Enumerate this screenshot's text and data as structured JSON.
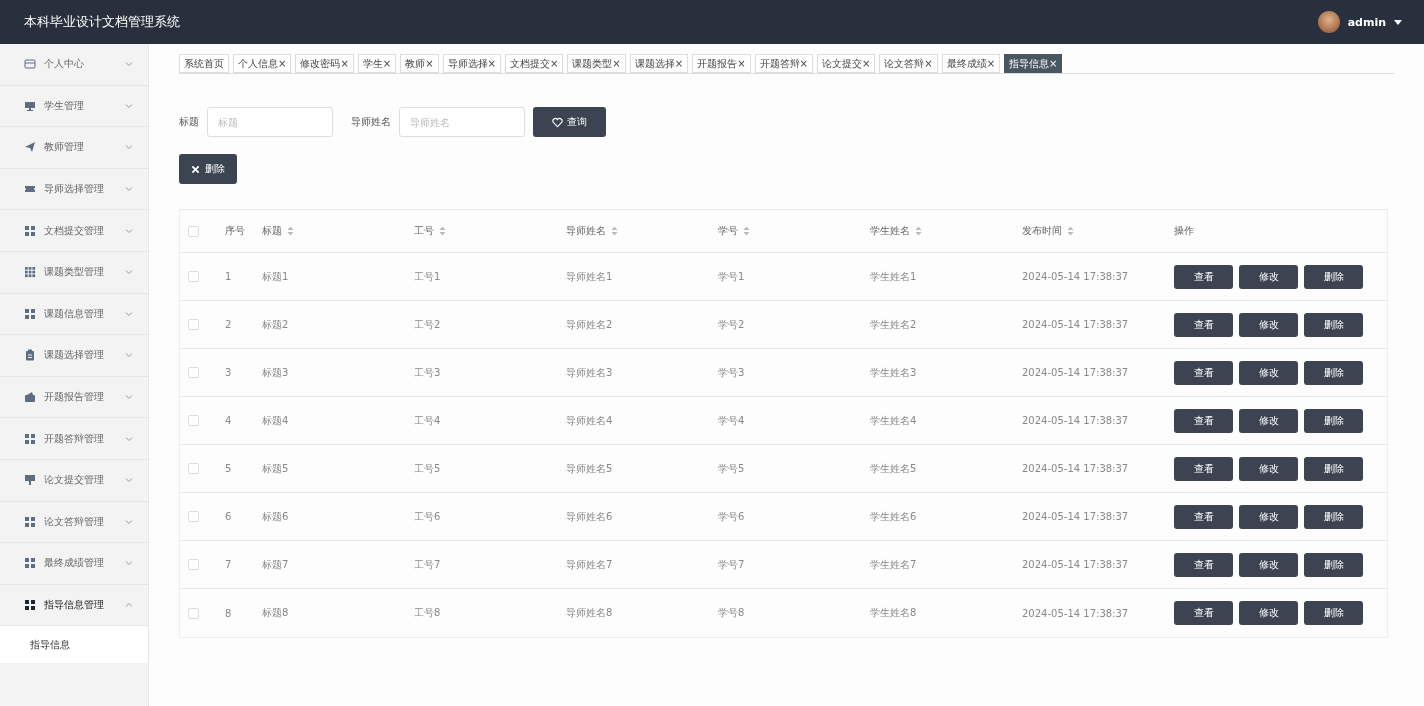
{
  "header": {
    "title": "本科毕业设计文档管理系统",
    "user": "admin"
  },
  "sidebar": {
    "items": [
      {
        "label": "个人中心",
        "expanded": false
      },
      {
        "label": "学生管理",
        "expanded": false
      },
      {
        "label": "教师管理",
        "expanded": false
      },
      {
        "label": "导师选择管理",
        "expanded": false
      },
      {
        "label": "文档提交管理",
        "expanded": false
      },
      {
        "label": "课题类型管理",
        "expanded": false
      },
      {
        "label": "课题信息管理",
        "expanded": false
      },
      {
        "label": "课题选择管理",
        "expanded": false
      },
      {
        "label": "开题报告管理",
        "expanded": false
      },
      {
        "label": "开题答辩管理",
        "expanded": false
      },
      {
        "label": "论文提交管理",
        "expanded": false
      },
      {
        "label": "论文答辩管理",
        "expanded": false
      },
      {
        "label": "最终成绩管理",
        "expanded": false
      },
      {
        "label": "指导信息管理",
        "expanded": true,
        "children": [
          {
            "label": "指导信息"
          }
        ]
      }
    ]
  },
  "tabs": [
    {
      "label": "系统首页",
      "selected": false
    },
    {
      "label": "个人信息",
      "close": "×",
      "selected": false
    },
    {
      "label": "修改密码",
      "close": "×",
      "selected": false
    },
    {
      "label": "学生",
      "close": "×",
      "selected": false
    },
    {
      "label": "教师",
      "close": "×",
      "selected": false
    },
    {
      "label": "导师选择",
      "close": "×",
      "selected": false
    },
    {
      "label": "文档提交",
      "close": "×",
      "selected": false
    },
    {
      "label": "课题类型",
      "close": "×",
      "selected": false
    },
    {
      "label": "课题选择",
      "close": "×",
      "selected": false
    },
    {
      "label": "开题报告",
      "close": "×",
      "selected": false
    },
    {
      "label": "开题答辩",
      "close": "×",
      "selected": false
    },
    {
      "label": "论文提交",
      "close": "×",
      "selected": false
    },
    {
      "label": "论文答辩",
      "close": "×",
      "selected": false
    },
    {
      "label": "最终成绩",
      "close": "×",
      "selected": false
    },
    {
      "label": "指导信息",
      "close": "×",
      "selected": true
    }
  ],
  "search": {
    "fields": [
      {
        "label": "标题",
        "placeholder": "标题"
      },
      {
        "label": "导师姓名",
        "placeholder": "导师姓名"
      }
    ],
    "button": "查询"
  },
  "delete_button": "删除",
  "table": {
    "header_checked": false,
    "columns": [
      {
        "label": "序号",
        "sortable": false
      },
      {
        "label": "标题",
        "sortable": true
      },
      {
        "label": "工号",
        "sortable": true
      },
      {
        "label": "导师姓名",
        "sortable": true
      },
      {
        "label": "学号",
        "sortable": true
      },
      {
        "label": "学生姓名",
        "sortable": true
      },
      {
        "label": "发布时间",
        "sortable": true
      },
      {
        "label": "操作",
        "sortable": false
      }
    ],
    "rows": [
      {
        "checked": false,
        "cells": [
          "1",
          "标题1",
          "工号1",
          "导师姓名1",
          "学号1",
          "学生姓名1",
          "2024-05-14 17:38:37"
        ],
        "actions": [
          "查看",
          "修改",
          "删除"
        ]
      },
      {
        "checked": false,
        "cells": [
          "2",
          "标题2",
          "工号2",
          "导师姓名2",
          "学号2",
          "学生姓名2",
          "2024-05-14 17:38:37"
        ],
        "actions": [
          "查看",
          "修改",
          "删除"
        ]
      },
      {
        "checked": false,
        "cells": [
          "3",
          "标题3",
          "工号3",
          "导师姓名3",
          "学号3",
          "学生姓名3",
          "2024-05-14 17:38:37"
        ],
        "actions": [
          "查看",
          "修改",
          "删除"
        ]
      },
      {
        "checked": false,
        "cells": [
          "4",
          "标题4",
          "工号4",
          "导师姓名4",
          "学号4",
          "学生姓名4",
          "2024-05-14 17:38:37"
        ],
        "actions": [
          "查看",
          "修改",
          "删除"
        ]
      },
      {
        "checked": false,
        "cells": [
          "5",
          "标题5",
          "工号5",
          "导师姓名5",
          "学号5",
          "学生姓名5",
          "2024-05-14 17:38:37"
        ],
        "actions": [
          "查看",
          "修改",
          "删除"
        ]
      },
      {
        "checked": false,
        "cells": [
          "6",
          "标题6",
          "工号6",
          "导师姓名6",
          "学号6",
          "学生姓名6",
          "2024-05-14 17:38:37"
        ],
        "actions": [
          "查看",
          "修改",
          "删除"
        ]
      },
      {
        "checked": false,
        "cells": [
          "7",
          "标题7",
          "工号7",
          "导师姓名7",
          "学号7",
          "学生姓名7",
          "2024-05-14 17:38:37"
        ],
        "actions": [
          "查看",
          "修改",
          "删除"
        ]
      },
      {
        "checked": false,
        "cells": [
          "8",
          "标题8",
          "工号8",
          "导师姓名8",
          "学号8",
          "学生姓名8",
          "2024-05-14 17:38:37"
        ],
        "actions": [
          "查看",
          "修改",
          "删除"
        ]
      }
    ]
  }
}
